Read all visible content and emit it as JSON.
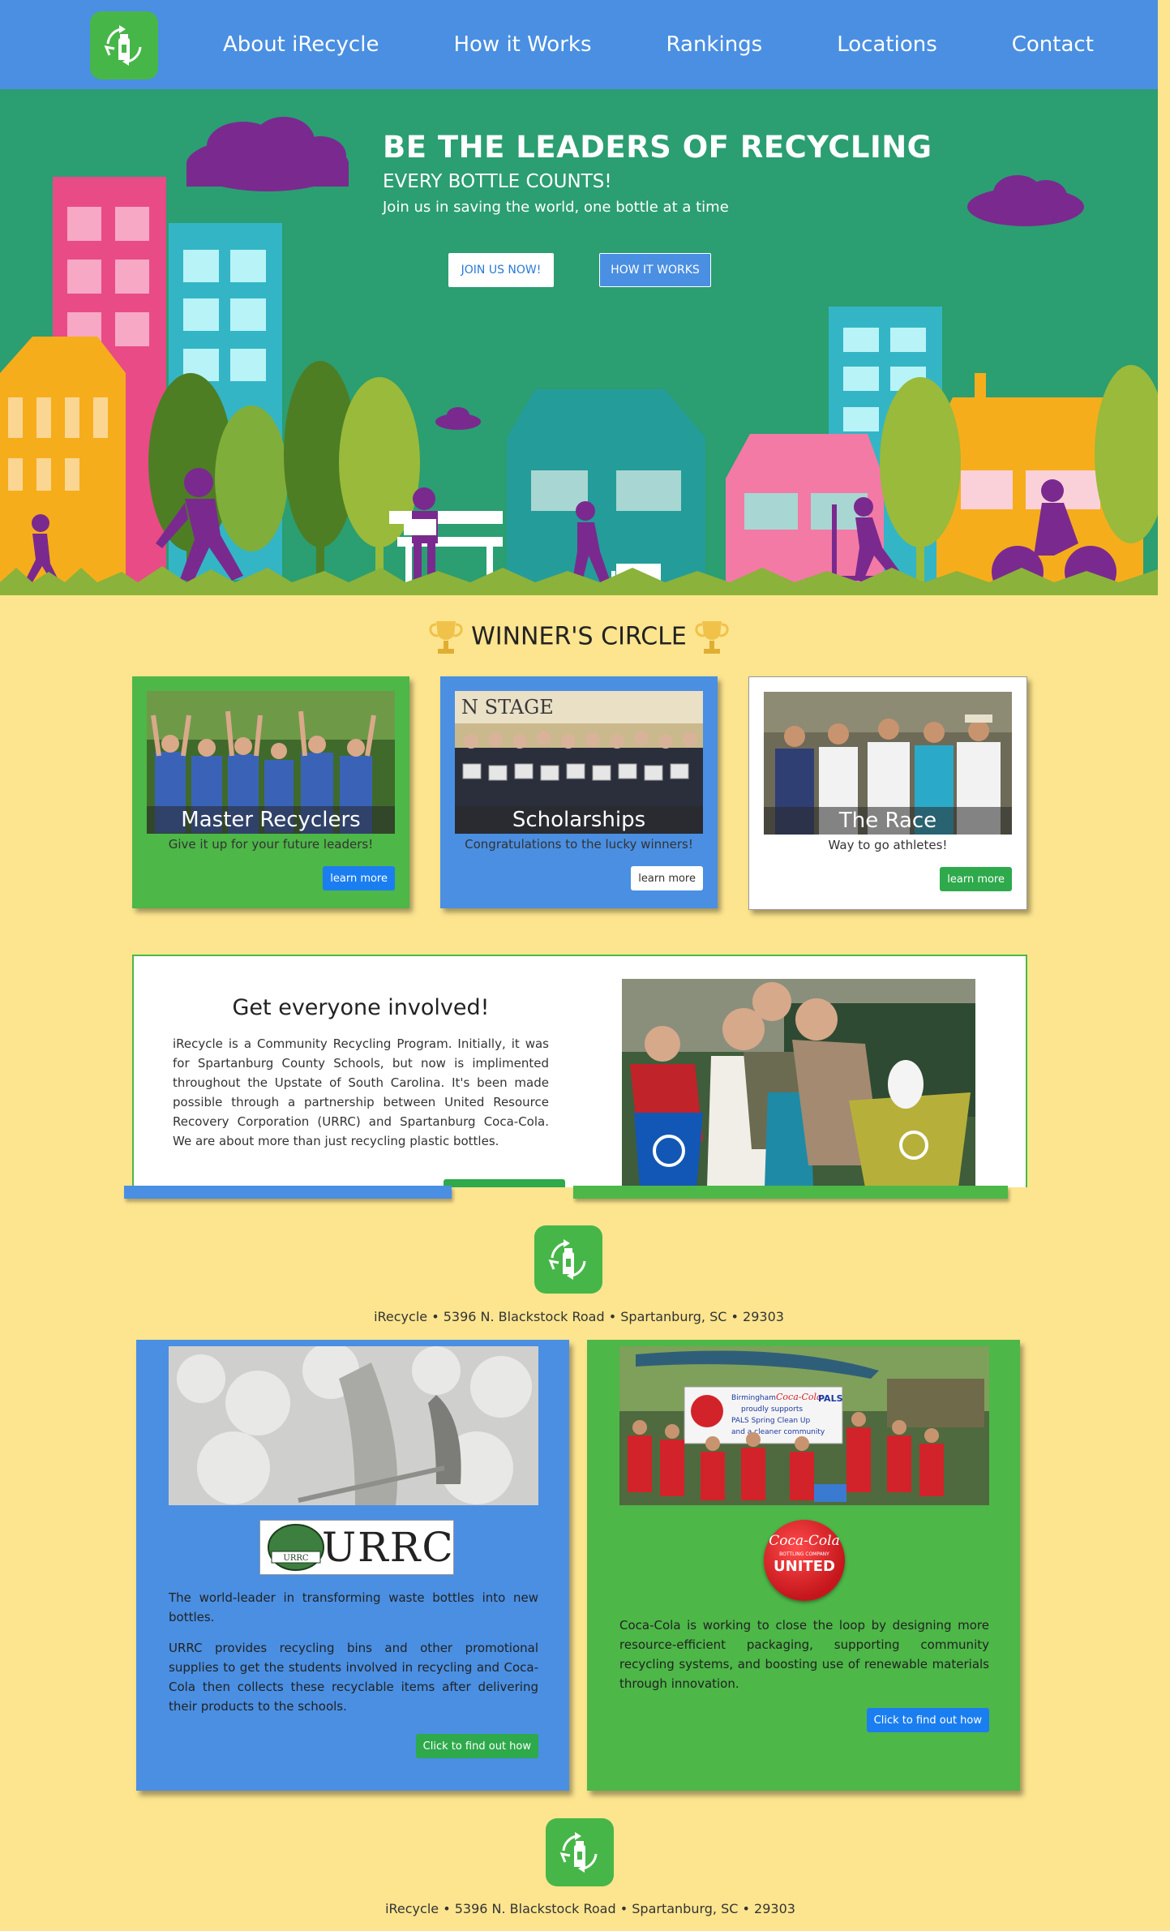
{
  "nav": {
    "logo": "irecycle-logo",
    "links": [
      "About iRecycle",
      "How it Works",
      "Rankings",
      "Locations",
      "Contact"
    ]
  },
  "hero": {
    "title": "BE THE LEADERS OF RECYCLING",
    "subtitle": "EVERY BOTTLE COUNTS!",
    "tagline": "Join us in saving the world, one bottle at a time",
    "join_button": "JOIN US NOW!",
    "how_button": "HOW IT WORKS"
  },
  "winners": {
    "title": "WINNER'S CIRCLE",
    "icon": "trophy-icon",
    "cards": [
      {
        "title": "Master Recyclers",
        "caption": "Give it up for your future leaders!",
        "button": "learn more"
      },
      {
        "title": "Scholarships",
        "caption": "Congratulations to the lucky winners!",
        "button": "learn more"
      },
      {
        "title": "The Race",
        "caption": "Way to go athletes!",
        "button": "learn more"
      }
    ]
  },
  "involved": {
    "title": "Get everyone involved!",
    "text": "iRecycle is a Community Recycling Program. Initially, it was for Spartanburg County Schools, but now is implimented throughout the Upstate of South Carolina. It's been made possible through a partnership between United Resource Recovery Corporation (URRC) and Spartanburg Coca-Cola. We are about more than just recycling plastic bottles."
  },
  "address": "iRecycle • 5396 N. Blackstock Road • Spartanburg, SC • 29303",
  "partners": {
    "urrc": {
      "logo_text": "URRC",
      "paragraph1": "The world-leader in transforming waste bottles into new bottles.",
      "paragraph2": "URRC provides recycling bins and other promotional supplies to get the students involved in recycling and Coca-Cola then collects these recyclable items after delivering their products to the schools.",
      "button": "Click to find out how"
    },
    "coke": {
      "banner_line1": "Birmingham",
      "banner_line2": "Coca-Cola",
      "banner_line3": "proudly supports",
      "banner_line4": "PALS Spring Clean Up",
      "banner_line5": "and a cleaner community",
      "banner_pals": "PALS",
      "logo_line1": "Coca-Cola",
      "logo_line2": "BOTTLING COMPANY",
      "logo_line3": "UNITED",
      "paragraph": "Coca-Cola is working to close the loop by designing more resource-efficient packaging, supporting community recycling systems, and boosting use of renewable materials through innovation.",
      "button": "Click to find out how"
    }
  },
  "colors": {
    "nav_blue": "#4a8fe2",
    "brand_green": "#47b649",
    "hero_green": "#2b9e72",
    "page_yellow": "#fde58f",
    "button_blue": "#1b7ef0",
    "button_green": "#2ea94b"
  }
}
